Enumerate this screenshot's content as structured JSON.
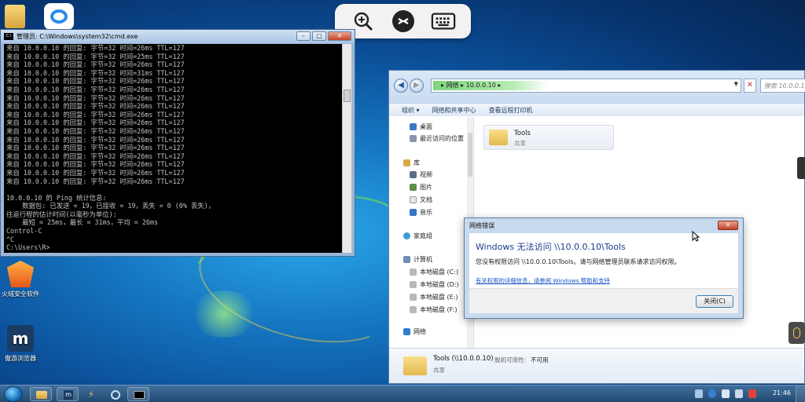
{
  "desktop": {
    "icons": [
      {
        "label": "火绒安全软件",
        "icon": "huorong-shield-icon"
      },
      {
        "label": "傲游浏览器",
        "icon": "maxthon-browser-icon"
      }
    ]
  },
  "remote_toolbar": {
    "buttons": [
      "zoom-in-icon",
      "remote-connect-icon",
      "keyboard-icon"
    ]
  },
  "cmd": {
    "title": "管理员: C:\\Windows\\system32\\cmd.exe",
    "lines": [
      "来自 10.0.0.10 的回复: 字节=32 时间=26ms TTL=127",
      "来自 10.0.0.10 的回复: 字节=32 时间=25ms TTL=127",
      "来自 10.0.0.10 的回复: 字节=32 时间=26ms TTL=127",
      "来自 10.0.0.10 的回复: 字节=32 时间=31ms TTL=127",
      "来自 10.0.0.10 的回复: 字节=32 时间=26ms TTL=127",
      "来自 10.0.0.10 的回复: 字节=32 时间=26ms TTL=127",
      "来自 10.0.0.10 的回复: 字节=32 时间=26ms TTL=127",
      "来自 10.0.0.10 的回复: 字节=32 时间=26ms TTL=127",
      "来自 10.0.0.10 的回复: 字节=32 时间=26ms TTL=127",
      "来自 10.0.0.10 的回复: 字节=32 时间=26ms TTL=127",
      "来自 10.0.0.10 的回复: 字节=32 时间=26ms TTL=127",
      "来自 10.0.0.10 的回复: 字节=32 时间=26ms TTL=127",
      "来自 10.0.0.10 的回复: 字节=32 时间=26ms TTL=127",
      "来自 10.0.0.10 的回复: 字节=32 时间=26ms TTL=127",
      "来自 10.0.0.10 的回复: 字节=32 时间=26ms TTL=127",
      "来自 10.0.0.10 的回复: 字节=32 时间=26ms TTL=127",
      "来自 10.0.0.10 的回复: 字节=32 时间=26ms TTL=127",
      "",
      "10.0.0.10 的 Ping 统计信息:",
      "    数据包: 已发送 = 19，已接收 = 19，丢失 = 0 (0% 丢失)，",
      "往返行程的估计时间(以毫秒为单位):",
      "    最短 = 25ms，最长 = 31ms，平均 = 26ms",
      "Control-C",
      "^C",
      "C:\\Users\\R>"
    ]
  },
  "explorer": {
    "breadcrumb": [
      "网络",
      "10.0.0.10"
    ],
    "search_placeholder": "搜索 10.0.0.10",
    "commands": [
      "组织 ▾",
      "网络和共享中心",
      "查看远程打印机"
    ],
    "nav": {
      "favorites": [
        "桌面",
        "最近访问的位置"
      ],
      "libraries_header": "库",
      "libraries": [
        "视频",
        "图片",
        "文档",
        "音乐"
      ],
      "homegroup": "家庭组",
      "computer_header": "计算机",
      "drives": [
        "本地磁盘 (C:)",
        "本地磁盘 (D:)",
        "本地磁盘 (E:)",
        "本地磁盘 (F:)"
      ],
      "network": "网络"
    },
    "items": [
      {
        "name": "Tools",
        "type": "共享"
      }
    ],
    "details": {
      "name": "Tools (\\\\10.0.0.10)",
      "status_label": "脱机可用性:",
      "status_value": "不可用",
      "type": "共享"
    }
  },
  "dialog": {
    "title": "网络错误",
    "heading": "Windows 无法访问 \\\\10.0.0.10\\Tools",
    "message": "您没有权限访问 \\\\10.0.0.10\\Tools。请与网络管理员联系请求访问权限。",
    "link": "有关权限的详细信息，请参阅 Windows 帮助和支持",
    "close_button": "关闭(C)"
  },
  "taskbar": {
    "clock": "21:46",
    "buttons": [
      "explorer-icon",
      "maxthon-icon",
      "bolt-icon",
      "remote-icon",
      "cmd-icon"
    ]
  },
  "colors": {
    "accent": "#1c3b8f",
    "link": "#1a56c9",
    "close_red": "#c7432a",
    "breadcrumb_green": "#7bd67b"
  }
}
